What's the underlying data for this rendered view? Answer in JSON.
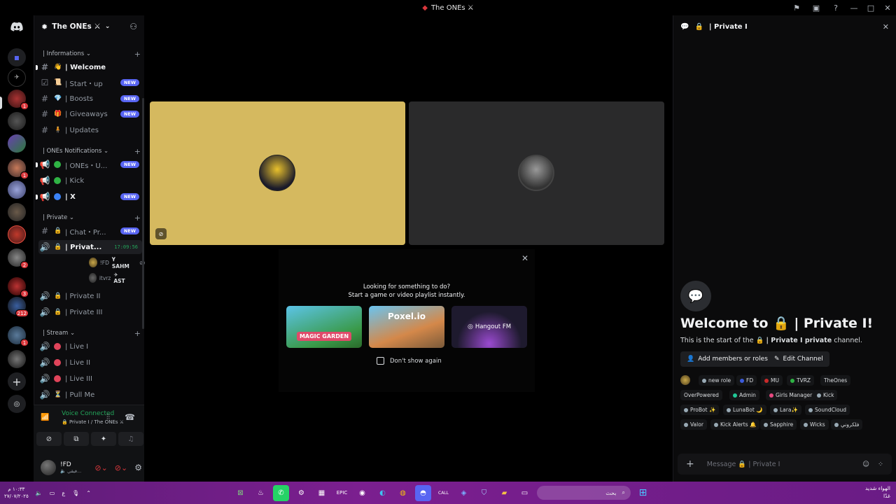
{
  "window": {
    "title": "The ONEs ⚔",
    "icons": [
      "inbox-icon",
      "download-icon",
      "help-icon"
    ]
  },
  "rail": {
    "badges": [
      "1",
      "1",
      "2",
      "3",
      "212",
      "1"
    ]
  },
  "server": {
    "name": "The ONEs ⚔"
  },
  "categories": [
    {
      "label": "| Informations ⌄"
    },
    {
      "label": "| ONEs Notifications ⌄"
    },
    {
      "label": "| Private ⌄"
    },
    {
      "label": "| Stream ⌄"
    }
  ],
  "channels": {
    "welcome": {
      "emoji": "👋",
      "name": "| Welcome"
    },
    "startup": {
      "emoji": "📜",
      "name": "| Start・up",
      "badge": "NEW"
    },
    "boosts": {
      "emoji": "💎",
      "name": "| Boosts",
      "badge": "NEW"
    },
    "giveaways": {
      "emoji": "🎁",
      "name": "| Giveaways",
      "badge": "NEW"
    },
    "updates": {
      "emoji": "🧍",
      "name": "| Updates"
    },
    "ones_u": {
      "name": "| ONEs・U...",
      "badge": "NEW"
    },
    "kick": {
      "name": "| Kick"
    },
    "x": {
      "name": "| X",
      "badge": "NEW"
    },
    "chat_pr": {
      "name": "| Chat・Pr...",
      "badge": "NEW"
    },
    "private_i": {
      "name": "| Privat...",
      "time": "17:09:56"
    },
    "private_ii": {
      "name": "| Private II"
    },
    "private_iii": {
      "name": "| Private III"
    },
    "live_i": {
      "name": "| Live I"
    },
    "live_ii": {
      "name": "| Live II"
    },
    "live_iii": {
      "name": "| Live III"
    },
    "pull_me": {
      "name": "| Pull Me"
    }
  },
  "voice_users": [
    {
      "name": "!FD",
      "tag": "𝐘 SAHM"
    },
    {
      "name": "itvrz",
      "tag": "✈ AST"
    }
  ],
  "voice_panel": {
    "status": "Voice Connected",
    "channel": "Private I / The ONEs ⚔"
  },
  "user": {
    "name": "!FD",
    "status": "🔈 فيقي..."
  },
  "activity": {
    "title_line1": "Looking for something to do?",
    "title_line2": "Start a game or video playlist instantly.",
    "cards": [
      "MAGIC GARDEN",
      "Poxel.io",
      "Hangout FM"
    ],
    "checkbox_label": "Don't show again"
  },
  "chat": {
    "header": "| Private I",
    "welcome_title": "Welcome to 🔒 | Private I!",
    "welcome_sub_a": "This is the start of the 🔒",
    "welcome_sub_b": "| Private I private",
    "welcome_sub_c": "channel.",
    "add_members": "Add members or roles",
    "edit_channel": "Edit Channel",
    "placeholder": "Message 🔒 | Private I"
  },
  "roles": [
    {
      "label": "new role",
      "color": "#99aab5"
    },
    {
      "label": "FD",
      "color": "#3b5bdb"
    },
    {
      "label": "MU",
      "color": "#c92a2a"
    },
    {
      "label": "TVRZ",
      "color": "#2fb344"
    },
    {
      "label": "TheOnes",
      "color": "#151618"
    },
    {
      "label": "OverPowered",
      "color": "#151618"
    },
    {
      "label": "Admin",
      "color": "#20c997"
    },
    {
      "label": "Girls Manager",
      "color": "#e64980"
    },
    {
      "label": "Kick",
      "color": "#99aab5"
    },
    {
      "label": "ProBot ✨",
      "color": "#99aab5"
    },
    {
      "label": "LunaBot 🌙",
      "color": "#99aab5"
    },
    {
      "label": "Lara✨",
      "color": "#99aab5"
    },
    {
      "label": "SoundCloud",
      "color": "#99aab5"
    },
    {
      "label": "Valor",
      "color": "#99aab5"
    },
    {
      "label": "Kick Alerts 🔔",
      "color": "#99aab5"
    },
    {
      "label": "Sapphire",
      "color": "#99aab5"
    },
    {
      "label": "Wicks",
      "color": "#99aab5"
    },
    {
      "label": "فلكروني",
      "color": "#99aab5"
    }
  ],
  "taskbar": {
    "search_label": "بحث",
    "time_line1": "١٠:٣٣ م",
    "time_line2": "٢٧/٠٧/٢٠٢٥",
    "weather_line1": "الهواء شديد",
    "weather_line2": "غدًا"
  },
  "colors": {
    "accent": "#5865f2",
    "online": "#23a55a",
    "danger": "#da373c",
    "tile_yellow": "#d5b95f",
    "tile_gray": "#2a2a2b"
  }
}
